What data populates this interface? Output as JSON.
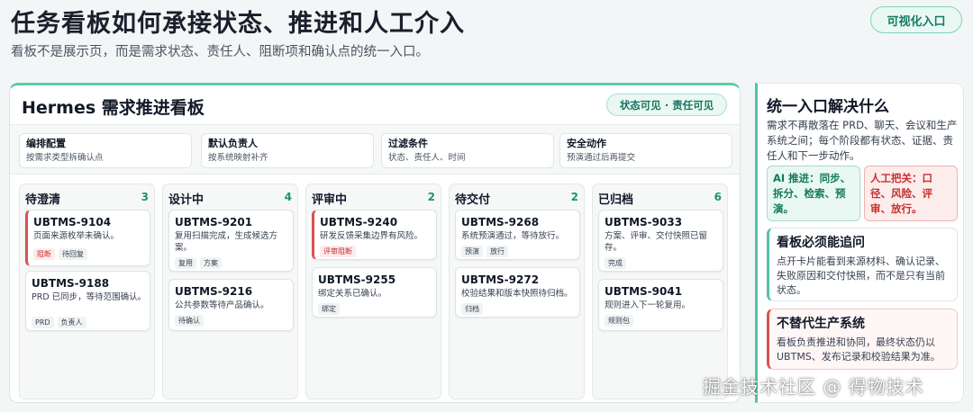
{
  "header": {
    "title": "任务看板如何承接状态、推进和人工介入",
    "subtitle": "看板不是展示页，而是需求状态、责任人、阻断项和确认点的统一入口。",
    "chip": "可视化入口"
  },
  "board": {
    "title": "Hermes 需求推进看板",
    "badge": "状态可见 · 责任可见",
    "configs": [
      {
        "title": "编排配置",
        "sub": "按需求类型拆确认点"
      },
      {
        "title": "默认负责人",
        "sub": "按系统映射补齐"
      },
      {
        "title": "过滤条件",
        "sub": "状态、责任人、时间"
      },
      {
        "title": "安全动作",
        "sub": "预演通过后再提交"
      }
    ],
    "columns": [
      {
        "name": "待澄清",
        "count": "3",
        "cards": [
          {
            "id": "UBTMS-9104",
            "desc": "页面来源枚举未确认。",
            "tags": [
              "阻断",
              "待回复"
            ]
          },
          {
            "id": "UBTMS-9188",
            "desc": "PRD 已同步，等待范围确认。",
            "tags": [
              "PRD",
              "负责人"
            ]
          }
        ]
      },
      {
        "name": "设计中",
        "count": "4",
        "cards": [
          {
            "id": "UBTMS-9201",
            "desc": "复用扫描完成，生成候选方案。",
            "tags": [
              "复用",
              "方案"
            ]
          },
          {
            "id": "UBTMS-9216",
            "desc": "公共参数等待产品确认。",
            "tags": [
              "待确认"
            ]
          }
        ]
      },
      {
        "name": "评审中",
        "count": "2",
        "cards": [
          {
            "id": "UBTMS-9240",
            "desc": "研发反馈采集边界有风险。",
            "tags": [
              "评审阻断"
            ]
          },
          {
            "id": "UBTMS-9255",
            "desc": "绑定关系已确认。",
            "tags": [
              "绑定"
            ]
          }
        ]
      },
      {
        "name": "待交付",
        "count": "2",
        "cards": [
          {
            "id": "UBTMS-9268",
            "desc": "系统预演通过，等待放行。",
            "tags": [
              "预演",
              "放行"
            ]
          },
          {
            "id": "UBTMS-9272",
            "desc": "校验结果和版本快照待归档。",
            "tags": [
              "归档"
            ]
          }
        ]
      },
      {
        "name": "已归档",
        "count": "6",
        "cards": [
          {
            "id": "UBTMS-9033",
            "desc": "方案、评审、交付快照已留存。",
            "tags": [
              "完成"
            ]
          },
          {
            "id": "UBTMS-9041",
            "desc": "规则进入下一轮复用。",
            "tags": [
              "规则包"
            ]
          }
        ]
      }
    ]
  },
  "side": {
    "title": "统一入口解决什么",
    "desc": "需求不再散落在 PRD、聊天、会议和生产系统之间；每个阶段都有状态、证据、责任人和下一步动作。",
    "ai_box": "AI 推进：同步、拆分、检索、预演。",
    "human_box": "人工把关：口径、风险、评审、放行。",
    "trace_title": "看板必须能追问",
    "trace_desc": "点开卡片能看到来源材料、确认记录、失败原因和交付快照，而不是只有当前状态。",
    "replace_title": "不替代生产系统",
    "replace_desc": "看板负责推进和协同，最终状态仍以 UBTMS、发布记录和校验结果为准。"
  },
  "watermark": "掘金技术社区 @ 得物技术",
  "colors": {
    "accent": "#55c2a6",
    "danger": "#d9534f"
  }
}
